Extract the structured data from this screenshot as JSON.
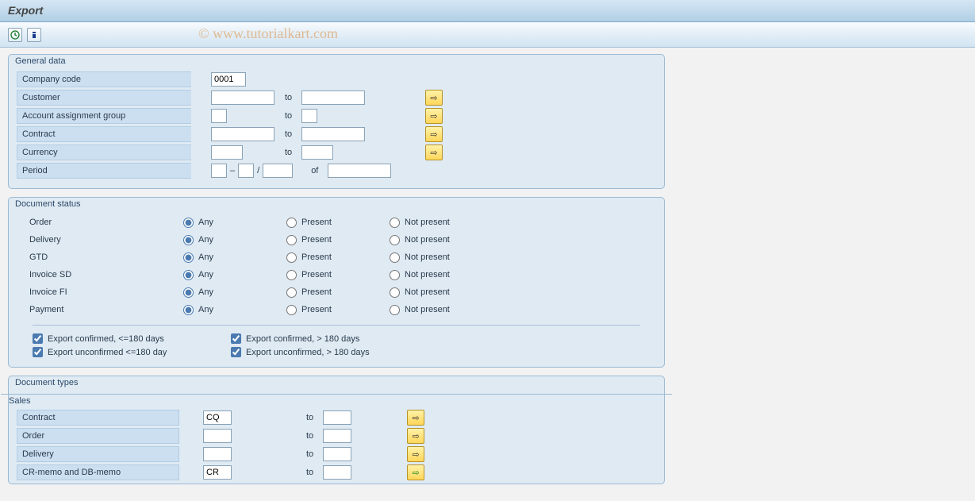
{
  "title": "Export",
  "watermark": "© www.tutorialkart.com",
  "groups": {
    "general": {
      "title": "General data",
      "company_code_label": "Company code",
      "company_code_value": "0001",
      "customer_label": "Customer",
      "acct_label": "Account assignment group",
      "contract_label": "Contract",
      "currency_label": "Currency",
      "period_label": "Period",
      "to_label": "to",
      "of_label": "of",
      "dash": "–",
      "slash": "/"
    },
    "status": {
      "title": "Document status",
      "rows": [
        {
          "label": "Order"
        },
        {
          "label": "Delivery"
        },
        {
          "label": "GTD"
        },
        {
          "label": "Invoice SD"
        },
        {
          "label": "Invoice FI"
        },
        {
          "label": "Payment"
        }
      ],
      "opt_any": "Any",
      "opt_present": "Present",
      "opt_notpresent": "Not present",
      "checks": {
        "c1": "Export confirmed, <=180 days",
        "c2": "Export confirmed, > 180 days",
        "c3": "Export unconfirmed <=180 day",
        "c4": "Export unconfirmed, > 180 days"
      }
    },
    "types": {
      "title": "Document types",
      "sales_title": "Sales",
      "contract_label": "Contract",
      "contract_value": "CQ",
      "order_label": "Order",
      "delivery_label": "Delivery",
      "memo_label": "CR-memo and DB-memo",
      "memo_value": "CR",
      "to_label": "to"
    }
  }
}
